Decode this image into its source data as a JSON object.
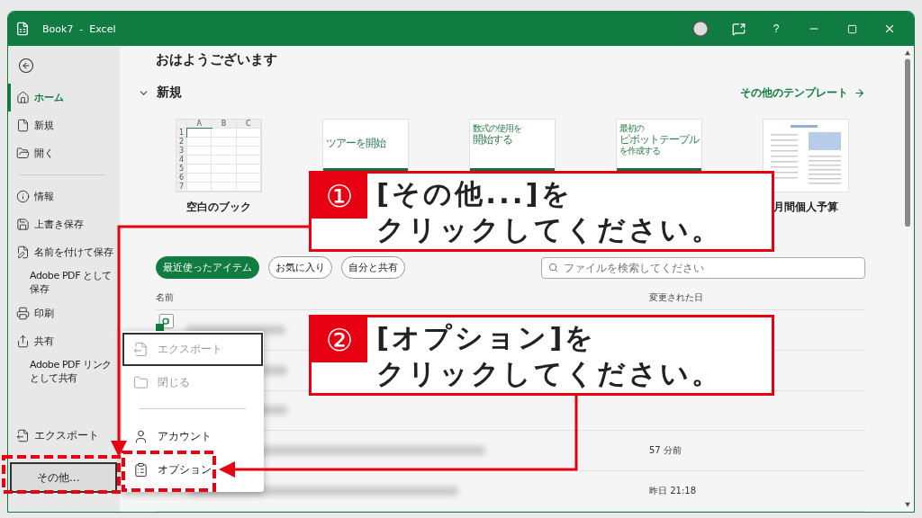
{
  "window": {
    "title": "Book7  -  Excel",
    "help_button": "?"
  },
  "sidebar": {
    "top_items": [
      {
        "label": "ホーム",
        "selected": true
      },
      {
        "label": "新規",
        "selected": false
      },
      {
        "label": "開く",
        "selected": false
      }
    ],
    "items": [
      {
        "lines": [
          "情報"
        ],
        "selected": false
      },
      {
        "lines": [
          "上書き保存"
        ],
        "selected": false
      },
      {
        "lines": [
          "名前を付けて保存"
        ],
        "selected": false
      },
      {
        "lines": [
          "Adobe PDF として",
          "保存"
        ],
        "selected": false
      },
      {
        "lines": [
          "印刷"
        ],
        "selected": false
      },
      {
        "lines": [
          "共有"
        ],
        "selected": false
      },
      {
        "lines": [
          "Adobe PDF リンク",
          "として共有"
        ],
        "selected": false
      }
    ],
    "bottom_items": [
      {
        "label": "エクスポート",
        "focused": false
      },
      {
        "label": "その他...",
        "focused": true
      }
    ]
  },
  "main": {
    "greeting": "おはようございます",
    "section_title": "新規",
    "more_templates_link": "その他のテンプレート",
    "templates": [
      {
        "kind": "sheet",
        "columns": [
          "A",
          "B",
          "C"
        ],
        "rows": [
          "1",
          "2",
          "3",
          "4",
          "5",
          "6",
          "7"
        ],
        "label": "空白のブック"
      },
      {
        "kind": "tour",
        "lines": [
          "ツアーを開始"
        ]
      },
      {
        "kind": "tour",
        "lines": [
          "数式の使用を",
          "開始する"
        ]
      },
      {
        "kind": "tour",
        "lines": [
          "最初の",
          "ピボットテーブル",
          "を作成する"
        ]
      },
      {
        "kind": "budget",
        "label": "月間個人予算"
      }
    ],
    "filters": [
      {
        "label": "最近使ったアイテム",
        "selected": true
      },
      {
        "label": "お気に入り",
        "selected": false
      },
      {
        "label": "自分と共有",
        "selected": false
      }
    ],
    "search": {
      "placeholder": "ファイルを検索してください"
    },
    "columns": [
      "名前",
      "変更された日"
    ],
    "rows": [
      {
        "kind": "excel"
      },
      {
        "kind": "hidden"
      },
      {
        "kind": "hidden"
      },
      {
        "kind": "hidden",
        "modified": "57 分前"
      },
      {
        "kind": "hidden",
        "modified": "昨日 21:18"
      }
    ]
  },
  "menu": {
    "items": [
      {
        "label": "エクスポート",
        "disabled": true,
        "focused": true
      },
      {
        "label": "閉じる",
        "disabled": true,
        "focused": false
      },
      {
        "label": "アカウント",
        "disabled": false,
        "focused": false
      },
      {
        "label": "オプション",
        "disabled": false,
        "focused": false
      }
    ]
  },
  "callouts": [
    {
      "number": "①",
      "lines": [
        "[その他...]を",
        "クリックしてください。"
      ]
    },
    {
      "number": "②",
      "lines": [
        "[オプション]を",
        "クリックしてください。"
      ]
    }
  ]
}
